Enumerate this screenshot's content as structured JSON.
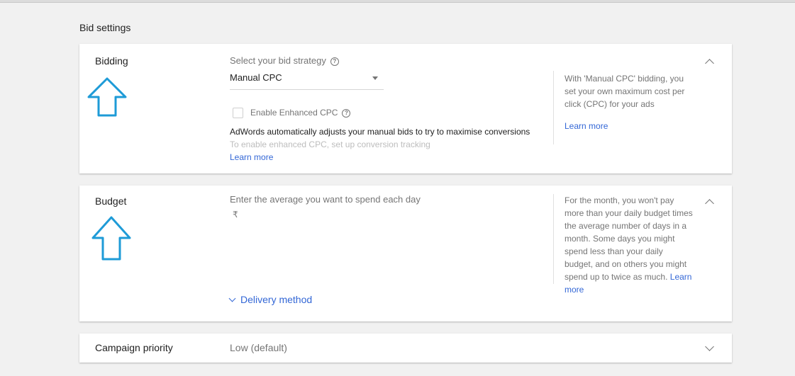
{
  "page": {
    "section_title": "Bid settings"
  },
  "bidding": {
    "label": "Bidding",
    "strategy_label": "Select your bid strategy",
    "strategy_value": "Manual CPC",
    "enhanced_cpc_label": "Enable Enhanced CPC",
    "enhanced_cpc_checked": false,
    "description": "AdWords automatically adjusts your manual bids to try to maximise conversions",
    "hint": "To enable enhanced CPC, set up conversion tracking",
    "learn_more": "Learn more",
    "side_text": "With 'Manual CPC' bidding, you set your own maximum cost per click (CPC) for your ads",
    "side_learn_more": "Learn more"
  },
  "budget": {
    "label": "Budget",
    "prompt": "Enter the average you want to spend each day",
    "currency": "₹",
    "delivery_method": "Delivery method",
    "side_text": "For the month, you won't pay more than your daily budget times the average number of days in a month. Some days you might spend less than your daily budget, and on others you might spend up to twice as much.",
    "side_learn_more": "Learn more"
  },
  "priority": {
    "label": "Campaign priority",
    "value": "Low (default)"
  },
  "colors": {
    "accent": "#3367d6",
    "annotation_arrow": "#1e9bd7"
  },
  "icons": [
    "help-circle-icon",
    "chevron-up-icon",
    "chevron-down-icon",
    "dropdown-caret-icon",
    "up-arrow-annotation-icon"
  ]
}
